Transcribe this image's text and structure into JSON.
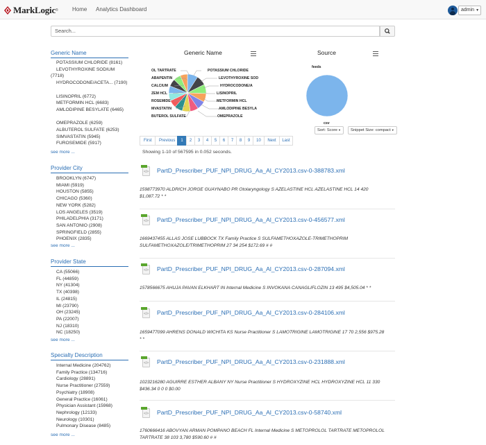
{
  "nav": {
    "logo_text": "MarkLogic",
    "logo_mark": "®",
    "home": "Home",
    "analytics": "Analytics Dashboard",
    "user": "admin"
  },
  "search": {
    "placeholder": "Search..."
  },
  "facets": {
    "generic_name": {
      "title": "Generic Name",
      "items": [
        "POTASSIUM CHLORIDE (8161)",
        "LEVOTHYROXINE SODIUM",
        "(7718)",
        "HYDROCODONE/ACETA... (7190)",
        "",
        "LISINOPRIL (6772)",
        "METFORMIN HCL (6683)",
        "AMLODIPINE BESYLATE (6465)",
        "",
        "OMEPRAZOLE (6259)",
        "ALBUTEROL SULFATE (6253)",
        "SIMVASTATIN (5945)",
        "FUROSEMIDE (5917)"
      ],
      "more": "see more ..."
    },
    "provider_city": {
      "title": "Provider City",
      "items": [
        "BROOKLYN (6747)",
        "MIAMI (5919)",
        "HOUSTON (5855)",
        "CHICAGO (5360)",
        "NEW YORK (5282)",
        "LOS ANGELES (3519)",
        "PHILADELPHIA (3171)",
        "SAN ANTONIO (2908)",
        "SPRINGFIELD (2855)",
        "PHOENIX (2835)"
      ],
      "more": "see more ..."
    },
    "provider_state": {
      "title": "Provider State",
      "items": [
        "CA (55066)",
        "FL (44859)",
        "NY (41304)",
        "TX (40398)",
        "IL (24815)",
        "MI (23790)",
        "OH (23245)",
        "PA (22007)",
        "NJ (18310)",
        "NC (18250)"
      ],
      "more": "see more ..."
    },
    "specialty": {
      "title": "Specialty Description",
      "items": [
        "Internal Medicine (204762)",
        "Family Practice (134716)",
        "Cardiology (28891)",
        "Nurse Practitioner (27559)",
        "Psychiatry (18908)",
        "General Practice (16061)",
        "Physician Assistant (15968)",
        "Nephrology (12133)",
        "Neurology (10301)",
        "Pulmonary Disease (8485)"
      ],
      "more": "see more ..."
    }
  },
  "charts": {
    "generic_title": "Generic Name",
    "source_title": "Source",
    "generic_left_labels": [
      "OL TARTRATE",
      "ABAPENTIN",
      "CALCIUM",
      "ZEM HCL",
      "ROSEMIDE",
      "MVASTATIN",
      "BUTEROL SULFATE"
    ],
    "generic_right_labels": [
      "POTASSIUM CHLORIDE",
      "LEVOTHYROXINE SOD",
      "HYDROCODONE/A",
      "LISINOPRIL",
      "METFORMIN HCL",
      "AMLODIPINE BESYLA",
      "OMEPRAZOLE"
    ],
    "source_labels": [
      "feeds",
      "csv"
    ]
  },
  "chart_data": [
    {
      "type": "pie",
      "title": "Generic Name",
      "categories": [
        "POTASSIUM CHLORIDE",
        "LEVOTHYROXINE SODIUM",
        "HYDROCODONE/ACETA...",
        "LISINOPRIL",
        "METFORMIN HCL",
        "AMLODIPINE BESYLATE",
        "OMEPRAZOLE",
        "ALBUTEROL SULFATE",
        "SIMVASTATIN",
        "FUROSEMIDE",
        "DILTIAZEM HCL",
        "CALCIUM",
        "GABAPENTIN",
        "METOPROLOL TARTRATE"
      ],
      "values": [
        8161,
        7718,
        7190,
        6772,
        6683,
        6465,
        6259,
        6253,
        5945,
        5917,
        5800,
        5750,
        5700,
        5650
      ],
      "colors": [
        "#7cb5ec",
        "#434348",
        "#90ed7d",
        "#f7a35c",
        "#8085e9",
        "#f15c80",
        "#e4d354",
        "#2b908f",
        "#f45b5b",
        "#91e8e1",
        "#7cb5ec",
        "#434348",
        "#90ed7d",
        "#f7a35c"
      ]
    },
    {
      "type": "pie",
      "title": "Source",
      "categories": [
        "feeds",
        "csv"
      ],
      "values": [
        0.001,
        567595
      ],
      "colors": [
        "#434348",
        "#7cb5ec"
      ]
    }
  ],
  "controls": {
    "sort": "Sort: Score",
    "snippet": "Snippet Size: compact"
  },
  "pagination": [
    "First",
    "Previous",
    "1",
    "2",
    "3",
    "4",
    "5",
    "6",
    "7",
    "8",
    "9",
    "10",
    "Next",
    "Last"
  ],
  "status": "Showing 1-10 of 567595 in 0.052 seconds.",
  "results": [
    {
      "title": "PartD_Prescriber_PUF_NPI_DRUG_Aa_Al_CY2013.csv-0-388783.xml",
      "lines": [
        "1598773970 ALDRICH JORGE GUAYNABO PR Otolaryngology S AZELASTINE HCL AZELASTINE HCL 14 420",
        "$1,087.72 * *"
      ]
    },
    {
      "title": "PartD_Prescriber_PUF_NPI_DRUG_Aa_Al_CY2013.csv-0-456577.xml",
      "lines": [
        "1669437455 ALLAS JOSE LUBBOCK TX Family Practice S SULFAMETHOXAZOLE-TRIMETHOPRIM",
        "SULFAMETHOXAZOLE/TRIMETHOPRIM 27 34 254 $172.69 # #"
      ]
    },
    {
      "title": "PartD_Prescriber_PUF_NPI_DRUG_Aa_Al_CY2013.csv-0-287094.xml",
      "lines": [
        "1578566675 AHUJA PAVAN ELKHART IN Internal Medicine S INVOKANA CANAGLIFLOZIN 13 495 $4,505.04 * *"
      ]
    },
    {
      "title": "PartD_Prescriber_PUF_NPI_DRUG_Aa_Al_CY2013.csv-0-284106.xml",
      "lines": [
        "1659477099 AHRENS DONALD WICHITA KS Nurse Practitioner S LAMOTRIGINE LAMOTRIGINE 17 70 2,556 $975.28",
        "* *"
      ]
    },
    {
      "title": "PartD_Prescriber_PUF_NPI_DRUG_Aa_Al_CY2013.csv-0-231888.xml",
      "lines": [
        "1023216280 AGUIRRE ESTHER ALBANY NY Nurse Practitioner S HYDROXYZINE HCL HYDROXYZINE HCL 11 330",
        "$436.34 0 0 0 $0.00"
      ]
    },
    {
      "title": "PartD_Prescriber_PUF_NPI_DRUG_Aa_Al_CY2013.csv-0-58740.xml",
      "lines": [
        "1760666416 ABOVYAN ARMAN POMPANO BEACH FL Internal Medicine S METOPROLOL TARTRATE METOPROLOL",
        "TARTRATE 38 103 3,780 $590.60 # #"
      ]
    }
  ]
}
